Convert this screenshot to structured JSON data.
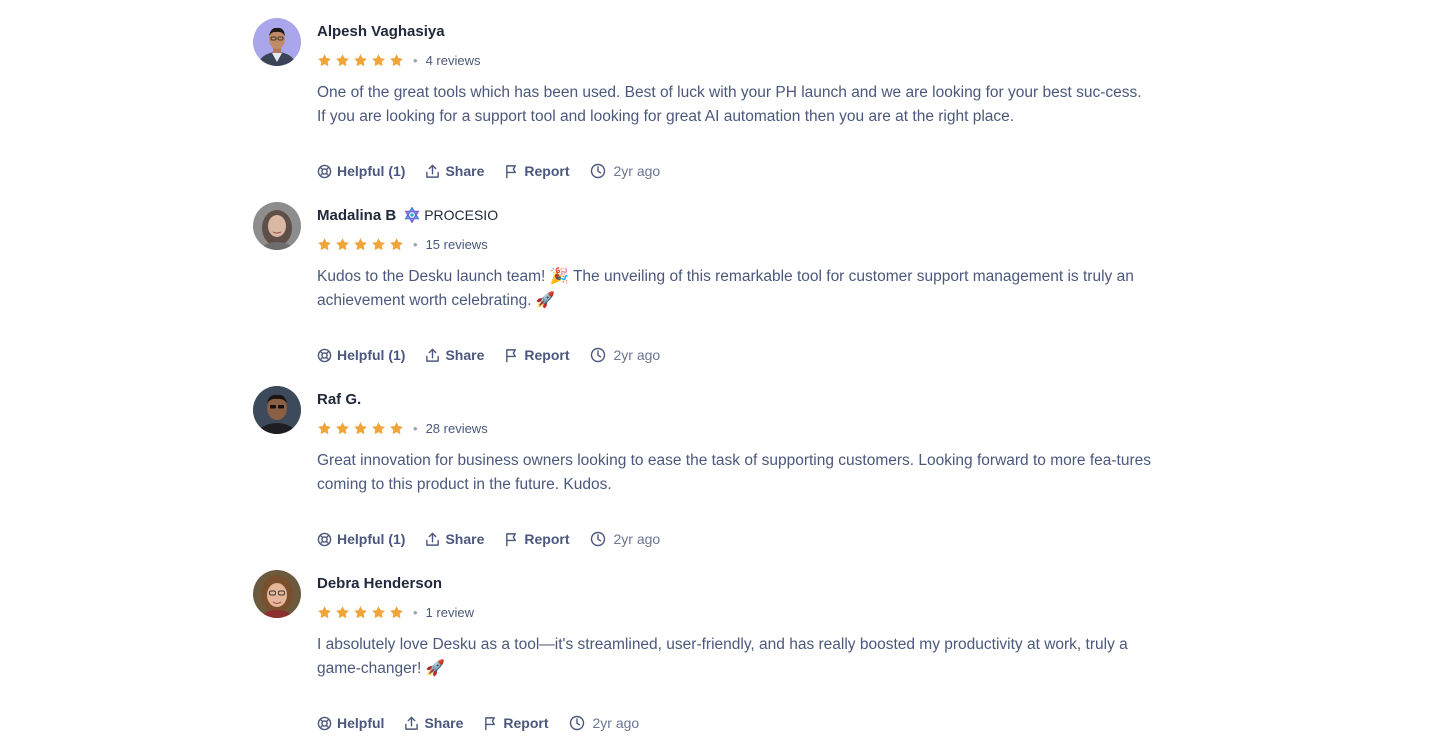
{
  "reviews": [
    {
      "name": "Alpesh Vaghasiya",
      "badge": "",
      "reviews_count": "4 reviews",
      "text": "One of the great tools which has been used. Best of luck with your PH launch and we are looking for your best suc-cess. If you are looking for a support tool and looking for great AI automation then you are at the right place.",
      "helpful": "Helpful (1)",
      "share": "Share",
      "report": "Report",
      "time": "2yr ago"
    },
    {
      "name": "Madalina B",
      "badge": "PROCESIO",
      "reviews_count": "15 reviews",
      "text": "Kudos to the Desku launch team! 🎉 The unveiling of this remarkable tool for customer support management is truly an achievement worth celebrating. 🚀",
      "helpful": "Helpful (1)",
      "share": "Share",
      "report": "Report",
      "time": "2yr ago"
    },
    {
      "name": "Raf G.",
      "badge": "",
      "reviews_count": "28 reviews",
      "text": "Great innovation for business owners looking to ease the task of supporting customers. Looking forward to more fea-tures coming to this product in the future. Kudos.",
      "helpful": "Helpful (1)",
      "share": "Share",
      "report": "Report",
      "time": "2yr ago"
    },
    {
      "name": "Debra Henderson",
      "badge": "",
      "reviews_count": "1 review",
      "text": "I absolutely love Desku as a tool—it's streamlined, user-friendly, and has really boosted my productivity at work, truly a game-changer! 🚀",
      "helpful": "Helpful",
      "share": "Share",
      "report": "Report",
      "time": "2yr ago"
    }
  ],
  "rating": {
    "stars": 5,
    "max": 5
  },
  "colors": {
    "star": "#f0a53b",
    "text": "#4b587c",
    "name": "#21293c"
  }
}
